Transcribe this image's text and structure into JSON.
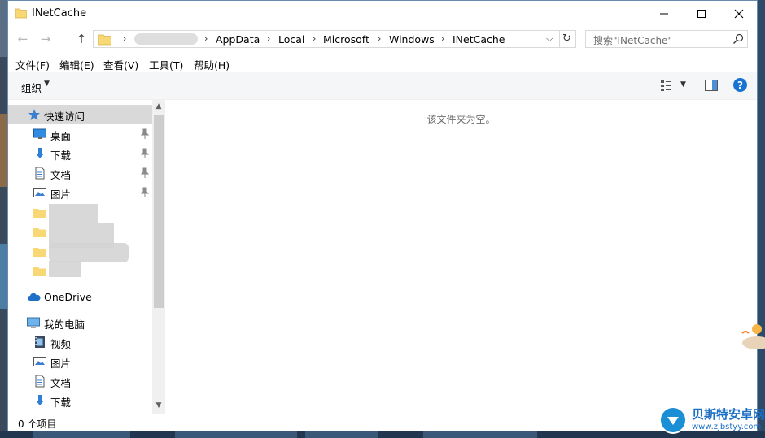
{
  "window": {
    "title": "INetCache",
    "controls": {
      "minimize": "—",
      "maximize": "☐",
      "close": "✕"
    }
  },
  "navigation": {
    "back": "←",
    "forward": "→",
    "up": "↑"
  },
  "address": {
    "breadcrumb": [
      "AppData",
      "Local",
      "Microsoft",
      "Windows",
      "INetCache"
    ],
    "separator": "›",
    "dropdown": "⌵",
    "refresh": "↻"
  },
  "search": {
    "placeholder": "搜索\"INetCache\""
  },
  "menubar": {
    "items": [
      "文件(F)",
      "编辑(E)",
      "查看(V)",
      "工具(T)",
      "帮助(H)"
    ]
  },
  "toolbar": {
    "organize": "组织",
    "dropdown_arrow": "▼",
    "help": "?"
  },
  "sidebar": {
    "quick_access": "快速访问",
    "quick_items": [
      {
        "label": "桌面",
        "icon": "desktop-icon"
      },
      {
        "label": "下载",
        "icon": "download-icon"
      },
      {
        "label": "文档",
        "icon": "document-icon"
      },
      {
        "label": "图片",
        "icon": "picture-icon"
      }
    ],
    "onedrive": "OneDrive",
    "this_pc": "我的电脑",
    "pc_items": [
      {
        "label": "视频",
        "icon": "video-icon"
      },
      {
        "label": "图片",
        "icon": "picture-icon"
      },
      {
        "label": "文档",
        "icon": "document-icon"
      },
      {
        "label": "下载",
        "icon": "download-icon"
      }
    ],
    "scroll_up": "▲",
    "scroll_down": "▼"
  },
  "content": {
    "empty_message": "该文件夹为空。"
  },
  "status": {
    "item_count": "0 个项目"
  },
  "watermark": {
    "title": "贝斯特安卓网",
    "url": "www.zjbstyy.com"
  },
  "colors": {
    "accent": "#1874d3",
    "folder": "#f8d775",
    "selected": "#d9d9d9"
  }
}
